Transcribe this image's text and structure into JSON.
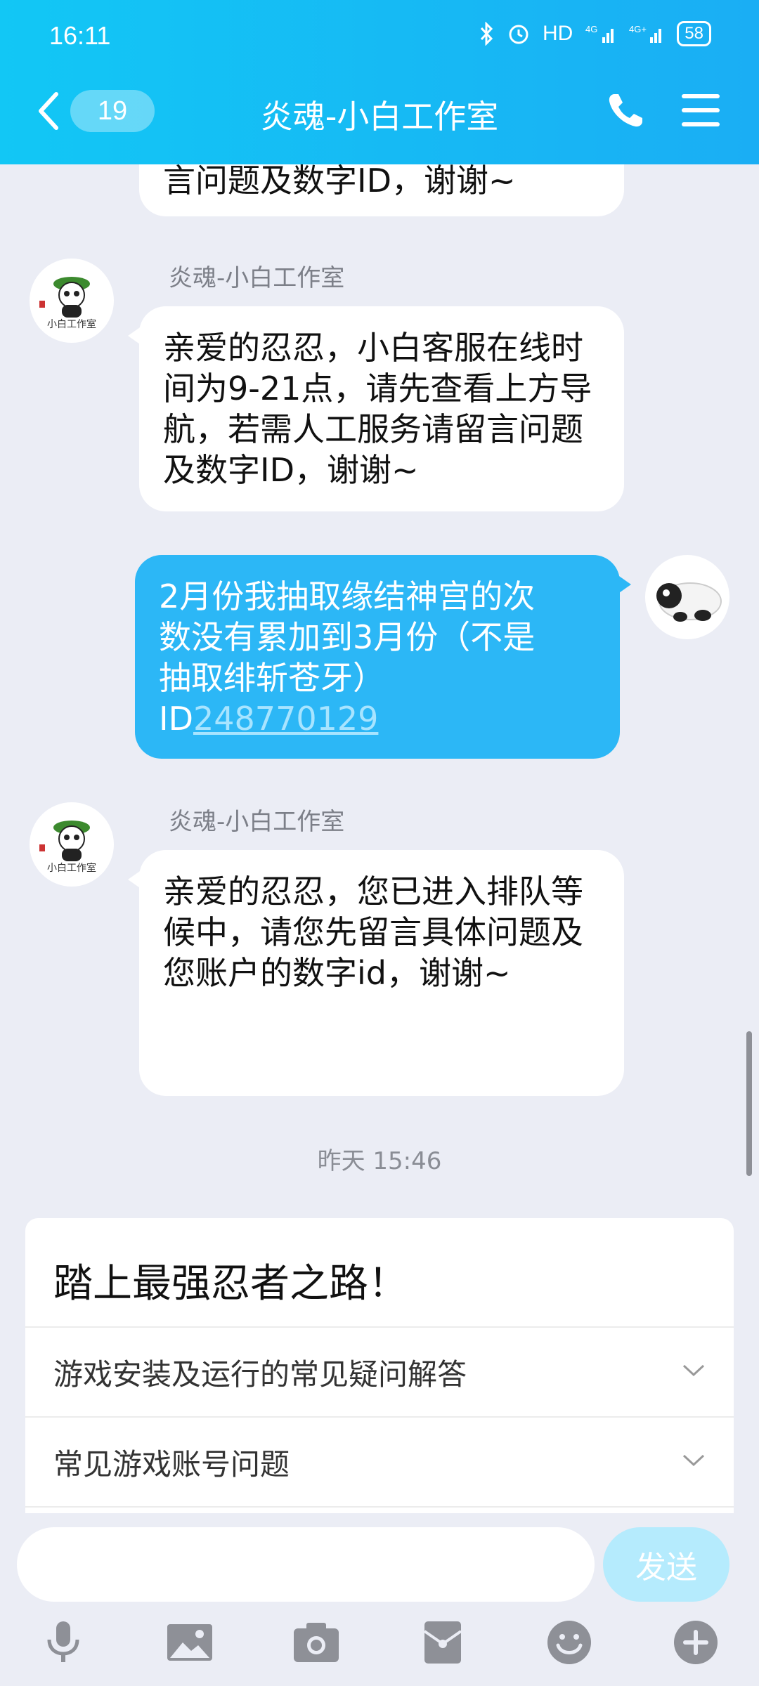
{
  "status_bar": {
    "time": "16:11",
    "network_label": "HD",
    "battery": "58"
  },
  "header": {
    "unread_count": "19",
    "title": "炎魂-小白工作室"
  },
  "messages": [
    {
      "text": "言问题及数字ID，谢谢~"
    },
    {
      "sender": "炎魂-小白工作室",
      "text": "亲爱的忍忍，小白客服在线时间为9-21点，请先查看上方导航，若需人工服务请留言问题及数字ID，谢谢~"
    },
    {
      "text_line1": "2月份我抽取缘结神宫的次",
      "text_line2": "数没有累加到3月份（不是",
      "text_line3": "抽取绯斩苍牙）",
      "id_prefix": "ID",
      "id_value": "248770129"
    },
    {
      "sender": "炎魂-小白工作室",
      "text": "亲爱的忍忍，您已进入排队等候中，请您先留言具体问题及您账户的数字id，谢谢~"
    }
  ],
  "avatar_label": "小白工作室",
  "timestamp": "昨天 15:46",
  "faq": {
    "title": "踏上最强忍者之路！",
    "items": [
      {
        "label": "游戏安装及运行的常见疑问解答"
      },
      {
        "label": "常见游戏账号问题"
      }
    ]
  },
  "input": {
    "placeholder": "",
    "send_label": "发送"
  },
  "toolbar": [
    "microphone-icon",
    "image-icon",
    "camera-icon",
    "red-packet-icon",
    "emoji-icon",
    "plus-icon"
  ],
  "colors": {
    "header": "#12C7F5",
    "my_bubble": "#2CB7F6",
    "send_disabled": "#B5EBFD",
    "background": "#EBEDF5"
  }
}
